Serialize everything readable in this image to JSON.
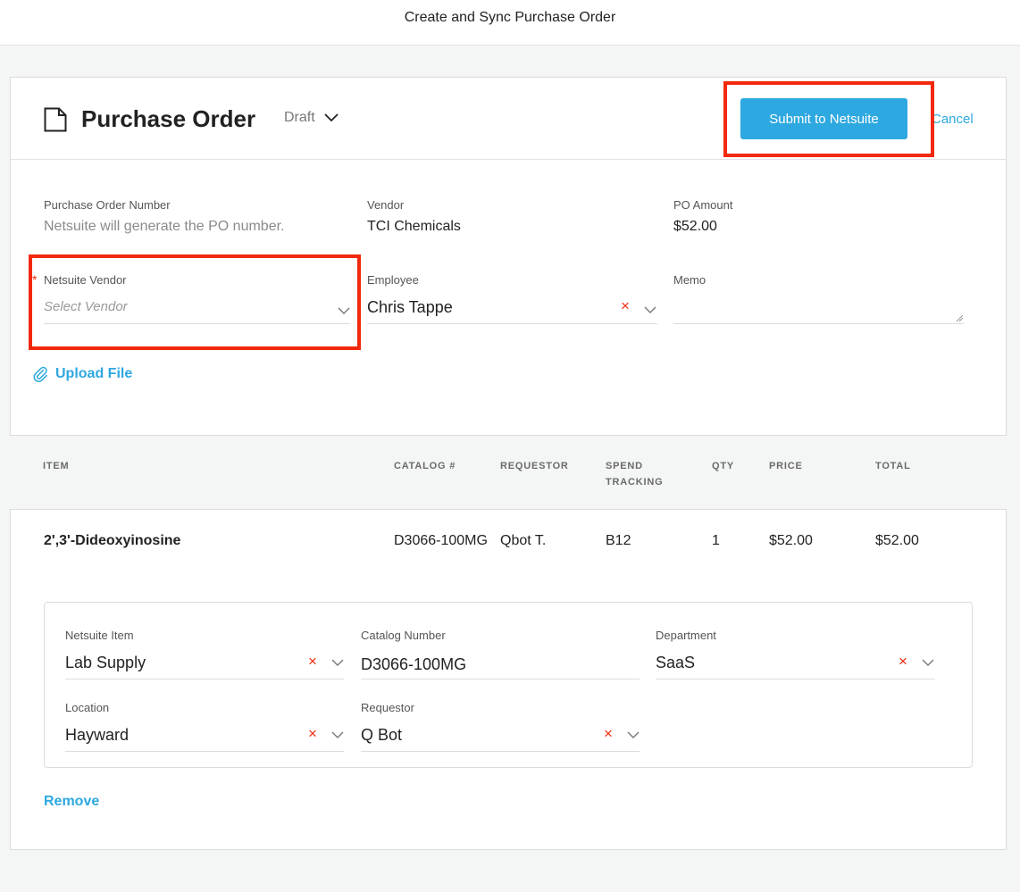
{
  "topbar": {
    "title": "Create and Sync Purchase Order"
  },
  "header": {
    "title": "Purchase Order",
    "status": "Draft",
    "submit_label": "Submit to Netsuite",
    "cancel_label": "Cancel"
  },
  "fields": {
    "po_number": {
      "label": "Purchase Order Number",
      "value": "Netsuite will generate the PO number."
    },
    "vendor": {
      "label": "Vendor",
      "value": "TCI Chemicals"
    },
    "po_amount": {
      "label": "PO Amount",
      "value": "$52.00"
    },
    "netsuite_vendor": {
      "label": "Netsuite Vendor",
      "placeholder": "Select Vendor",
      "required_mark": "*"
    },
    "employee": {
      "label": "Employee",
      "value": "Chris Tappe"
    },
    "memo": {
      "label": "Memo",
      "value": ""
    }
  },
  "upload_label": "Upload File",
  "table": {
    "columns": [
      "ITEM",
      "CATALOG #",
      "REQUESTOR",
      "SPEND TRACKING",
      "QTY",
      "PRICE",
      "TOTAL"
    ],
    "rows": [
      {
        "item": "2',3'-Dideoxyinosine",
        "catalog": "D3066-100MG",
        "requestor": "Qbot T.",
        "spend_tracking": "B12",
        "qty": "1",
        "price": "$52.00",
        "total": "$52.00"
      }
    ]
  },
  "line_detail": {
    "netsuite_item": {
      "label": "Netsuite Item",
      "value": "Lab Supply"
    },
    "catalog_number": {
      "label": "Catalog Number",
      "value": "D3066-100MG"
    },
    "department": {
      "label": "Department",
      "value": "SaaS"
    },
    "location": {
      "label": "Location",
      "value": "Hayward"
    },
    "requestor": {
      "label": "Requestor",
      "value": "Q Bot"
    }
  },
  "remove_label": "Remove",
  "icons": {
    "clear": "×",
    "accent_color": "#2ea8e0",
    "annotation_color": "#f2290c"
  }
}
